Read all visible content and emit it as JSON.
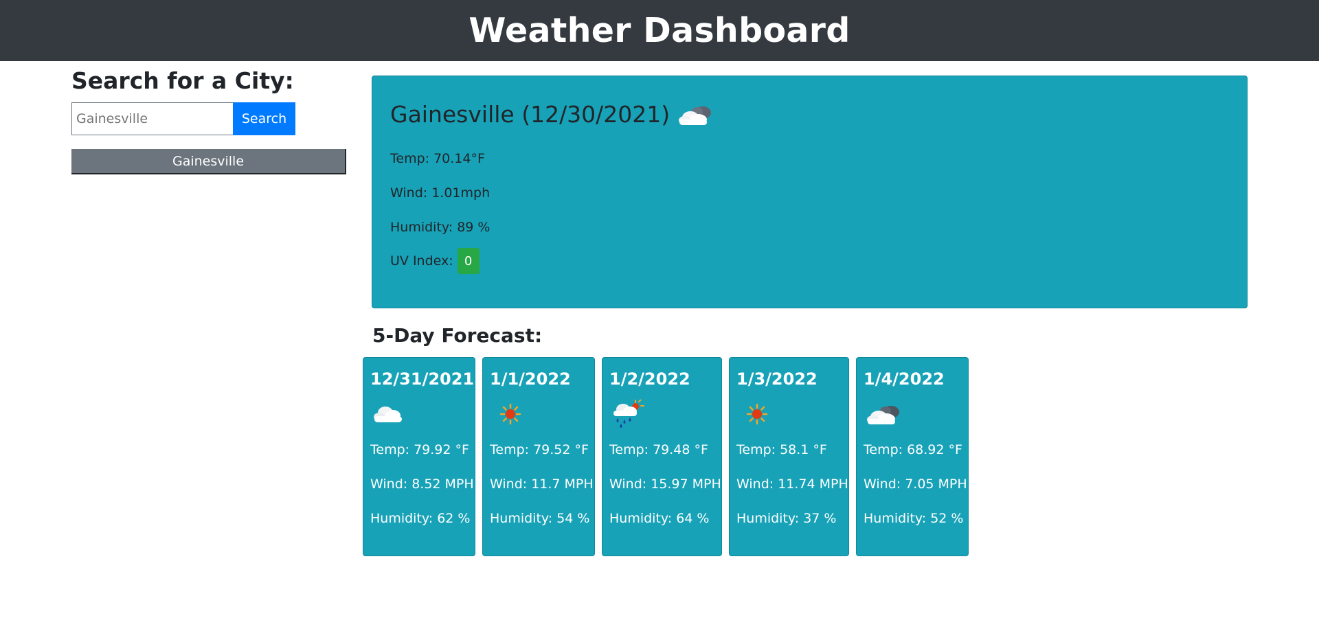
{
  "header": {
    "title": "Weather Dashboard"
  },
  "search": {
    "heading": "Search for a City:",
    "input_value": "",
    "placeholder": "Gainesville",
    "button_label": "Search"
  },
  "history": [
    {
      "label": "Gainesville"
    }
  ],
  "current": {
    "title": "Gainesville (12/30/2021)",
    "icon": "cloud-sun-icon",
    "temp": "Temp: 70.14°F",
    "wind": "Wind: 1.01mph",
    "humidity": "Humidity: 89 %",
    "uv_label": "UV Index:",
    "uv_value": "0",
    "uv_color": "#28a745"
  },
  "forecast": {
    "heading": "5-Day Forecast:",
    "days": [
      {
        "date": "12/31/2021",
        "icon": "cloud-icon",
        "temp": "Temp: 79.92 °F",
        "wind": "Wind: 8.52 MPH",
        "humidity": "Humidity: 62 %"
      },
      {
        "date": "1/1/2022",
        "icon": "sun-icon",
        "temp": "Temp: 79.52 °F",
        "wind": "Wind: 11.7 MPH",
        "humidity": "Humidity: 54 %"
      },
      {
        "date": "1/2/2022",
        "icon": "rain-sun-icon",
        "temp": "Temp: 79.48 °F",
        "wind": "Wind: 15.97 MPH",
        "humidity": "Humidity: 64 %"
      },
      {
        "date": "1/3/2022",
        "icon": "sun-icon",
        "temp": "Temp: 58.1 °F",
        "wind": "Wind: 11.74 MPH",
        "humidity": "Humidity: 37 %"
      },
      {
        "date": "1/4/2022",
        "icon": "broken-clouds-icon",
        "temp": "Temp: 68.92 °F",
        "wind": "Wind: 7.05 MPH",
        "humidity": "Humidity: 52 %"
      }
    ]
  },
  "colors": {
    "header_bg": "#343a40",
    "card_bg": "#17a2b8",
    "search_button": "#007bff",
    "history_button": "#6c757d"
  }
}
